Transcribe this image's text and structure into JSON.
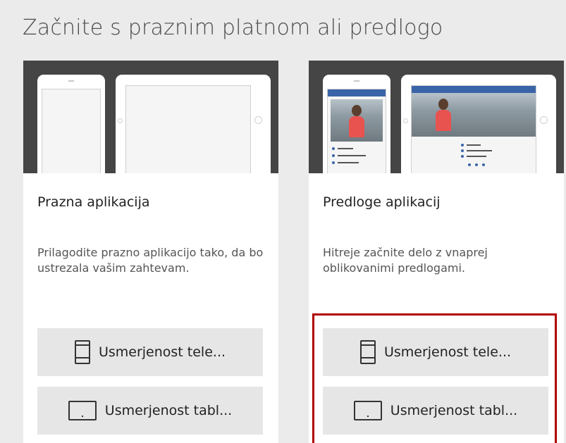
{
  "header": {
    "title": "Začnite s praznim platnom ali predlogo"
  },
  "colors": {
    "highlight": "#b00000",
    "template_accent": "#3a64a8",
    "preview_bg": "#454545"
  },
  "cards": [
    {
      "title": "Prazna aplikacija",
      "description": "Prilagodite prazno aplikacijo tako, da bo ustrezala vašim zahtevam.",
      "phone_button": {
        "label": "Usmerjenost tele...",
        "icon": "phone-icon"
      },
      "tablet_button": {
        "label": "Usmerjenost tabl...",
        "icon": "tablet-icon"
      }
    },
    {
      "title": "Predloge aplikacij",
      "description": "Hitreje začnite delo z vnaprej oblikovanimi predlogami.",
      "phone_button": {
        "label": "Usmerjenost tele...",
        "icon": "phone-icon"
      },
      "tablet_button": {
        "label": "Usmerjenost tabl...",
        "icon": "tablet-icon"
      }
    }
  ]
}
